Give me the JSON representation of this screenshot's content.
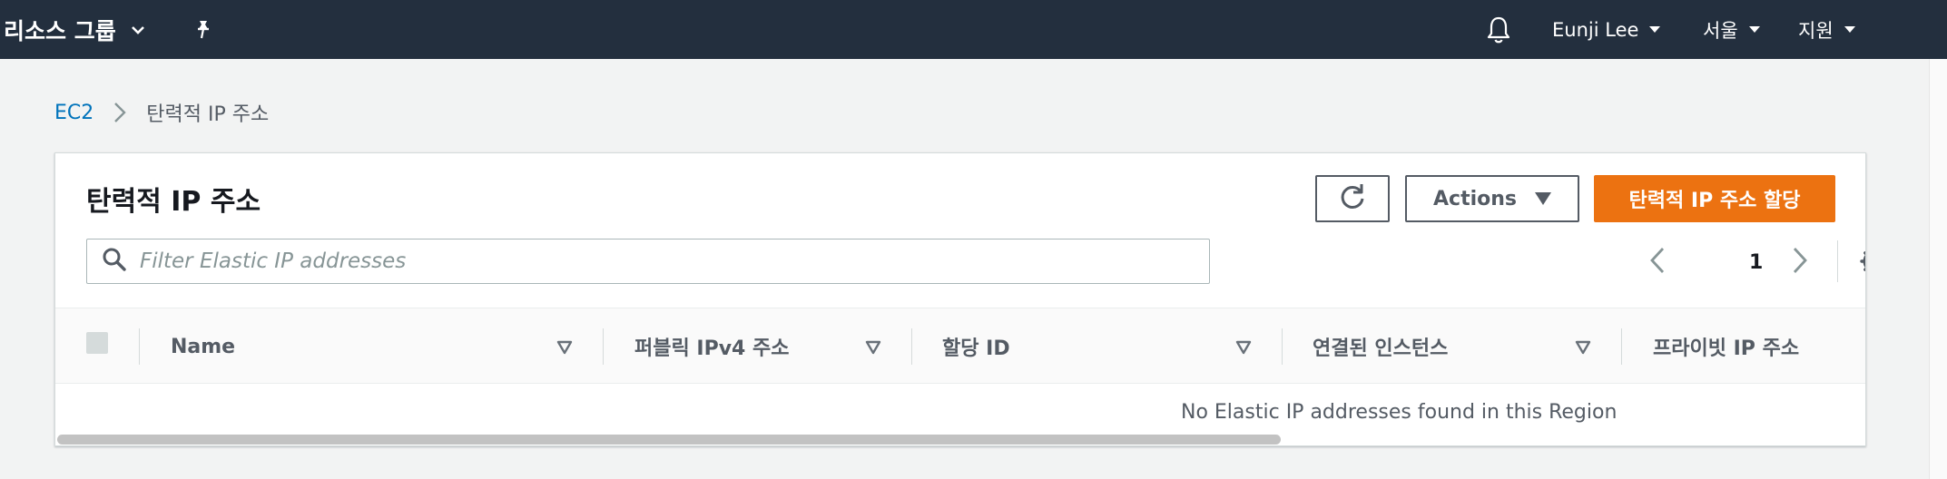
{
  "topnav": {
    "resource_groups": "리소스 그룹",
    "user": "Eunji Lee",
    "region": "서울",
    "support": "지원"
  },
  "breadcrumb": {
    "root": "EC2",
    "current": "탄력적 IP 주소"
  },
  "panel": {
    "title": "탄력적 IP 주소",
    "actions_label": "Actions",
    "allocate_label": "탄력적 IP 주소 할당",
    "filter_placeholder": "Filter Elastic IP addresses",
    "page_number": "1"
  },
  "table": {
    "columns": [
      "Name",
      "퍼블릭 IPv4 주소",
      "할당 ID",
      "연결된 인스턴스",
      "프라이빗 IP 주소"
    ],
    "empty_message": "No Elastic IP addresses found in this Region"
  },
  "colors": {
    "nav_bg": "#232f3e",
    "primary": "#ec7211",
    "link": "#0073bb"
  }
}
